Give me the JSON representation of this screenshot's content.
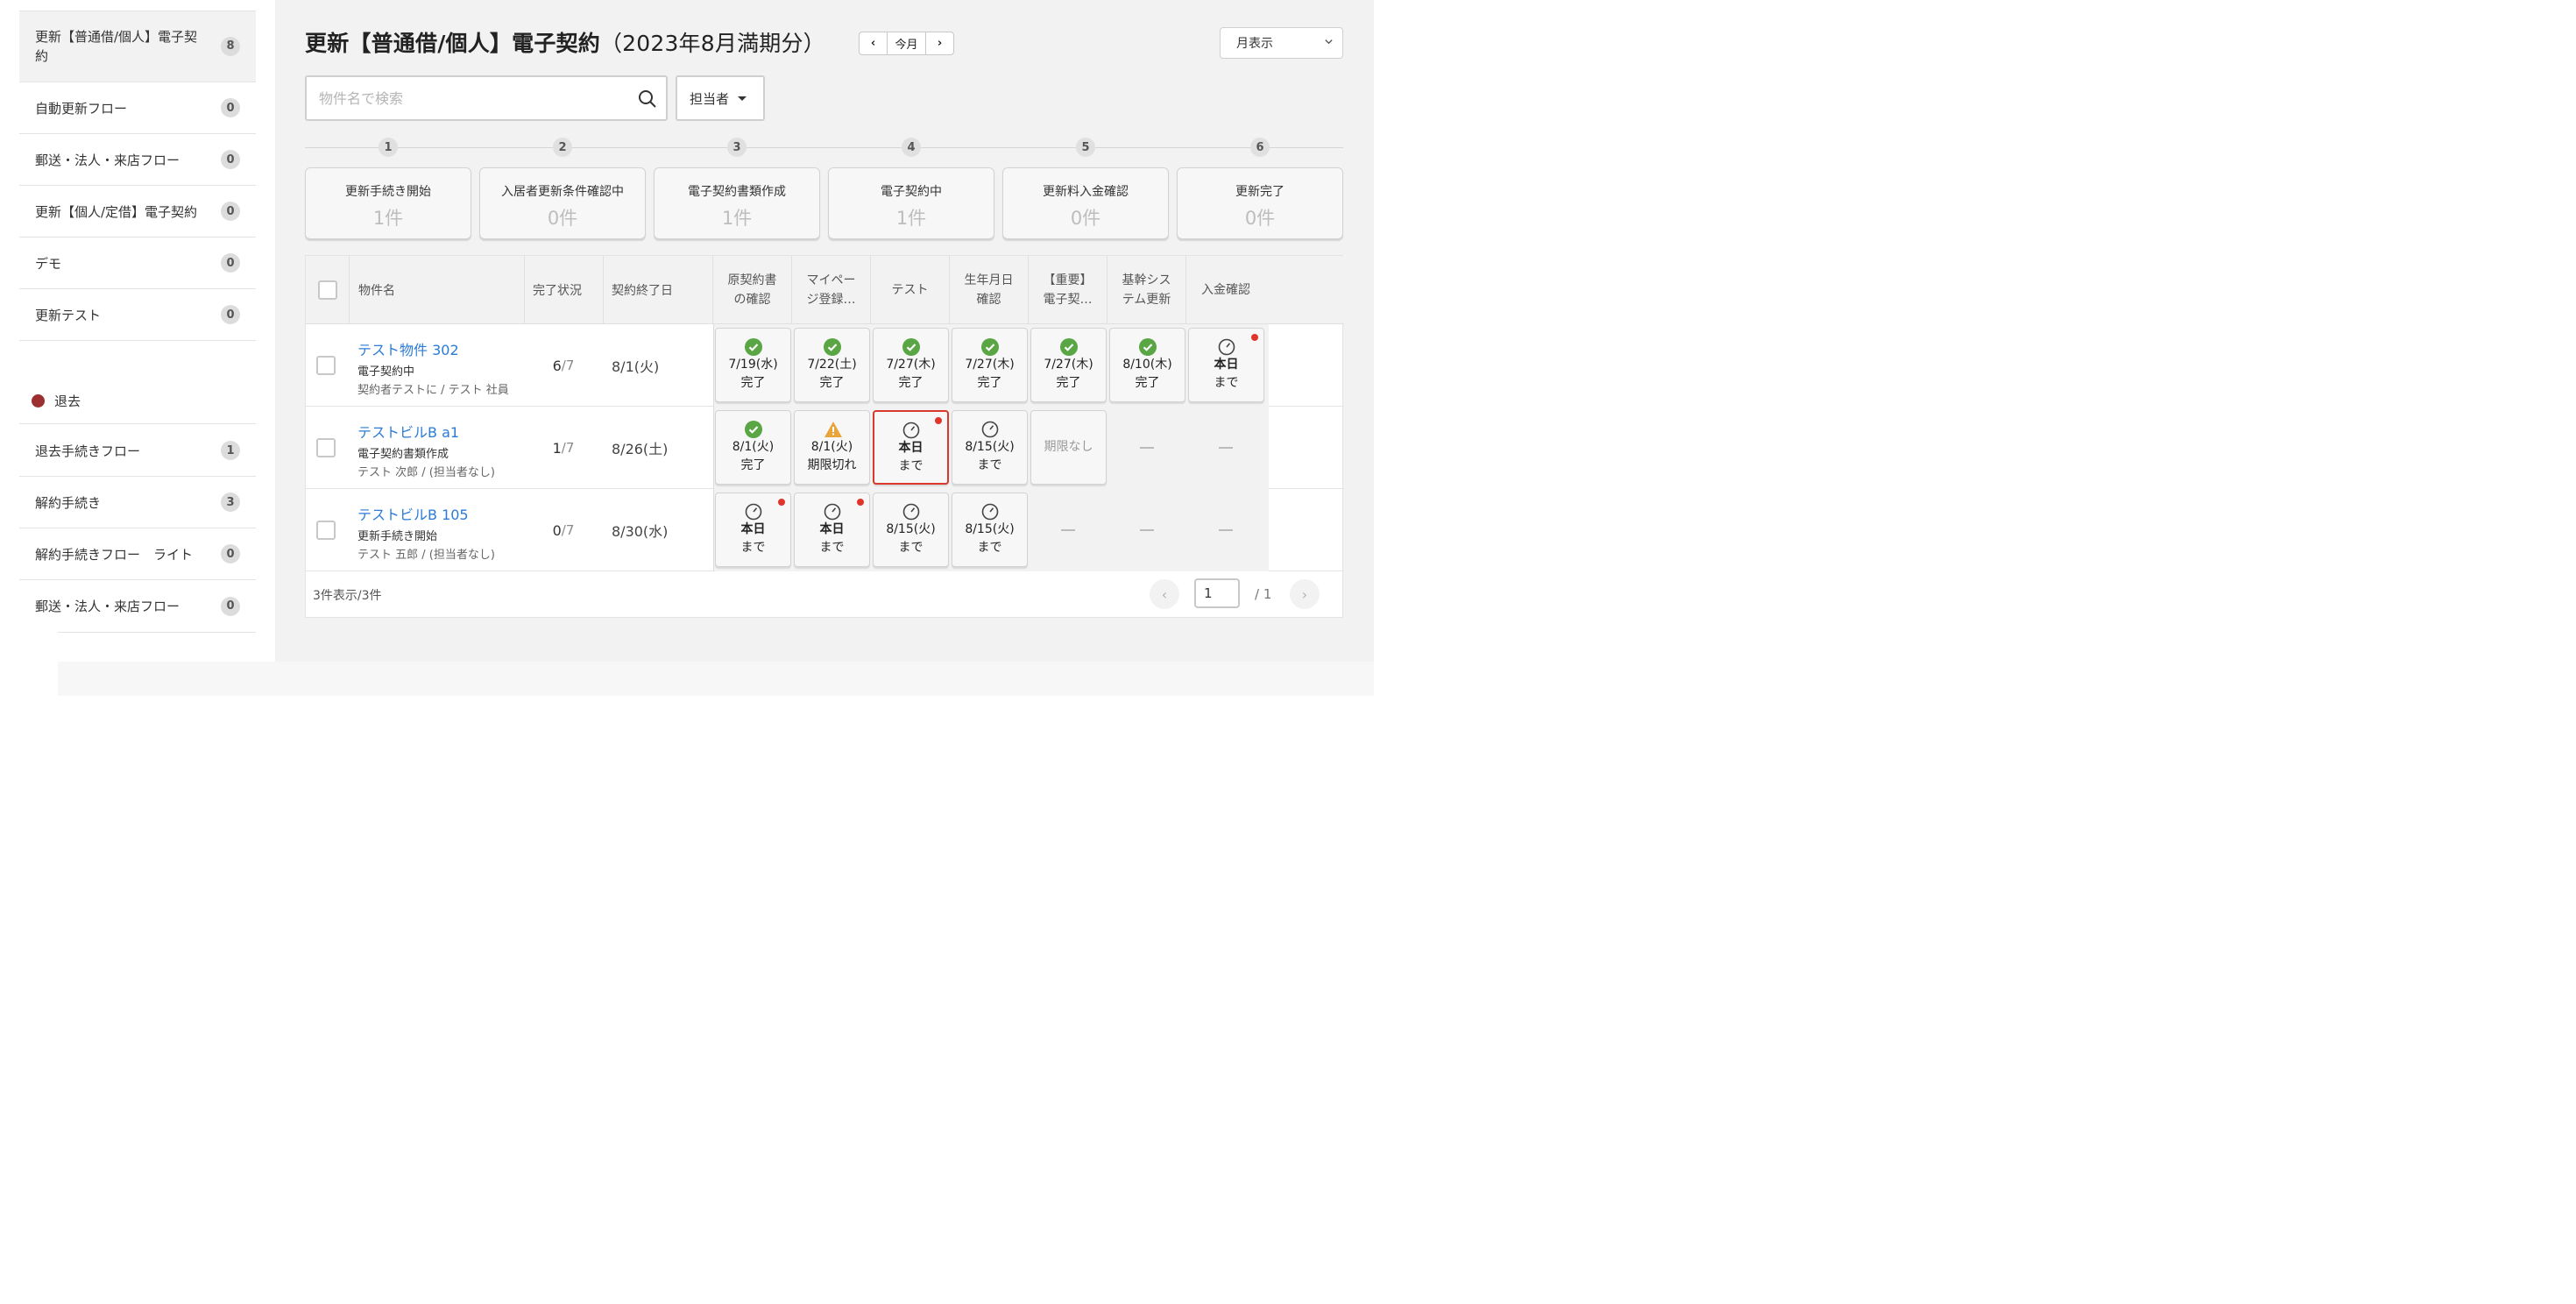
{
  "sidebar": {
    "items": [
      {
        "label": "更新【普通借/個人】電子契約",
        "count": "8"
      },
      {
        "label": "自動更新フロー",
        "count": "0"
      },
      {
        "label": "郵送・法人・来店フロー",
        "count": "0"
      },
      {
        "label": "更新【個人/定借】電子契約",
        "count": "0"
      },
      {
        "label": "デモ",
        "count": "0"
      },
      {
        "label": "更新テスト",
        "count": "0"
      }
    ],
    "section_label": "退去",
    "section_color": "#9c2f2f",
    "items2": [
      {
        "label": "退去手続きフロー",
        "count": "1"
      },
      {
        "label": "解約手続き",
        "count": "3"
      },
      {
        "label": "解約手続きフロー　ライト",
        "count": "0"
      },
      {
        "label": "郵送・法人・来店フロー",
        "count": "0"
      }
    ]
  },
  "header": {
    "title": "更新【普通借/個人】電子契約",
    "period": "（2023年8月満期分）",
    "prev": "‹",
    "today": "今月",
    "next": "›",
    "view_select": "月表示"
  },
  "search": {
    "placeholder": "物件名で検索",
    "value": ""
  },
  "assignee_label": "担当者",
  "steps": [
    {
      "num": "1",
      "label": "更新手続き開始",
      "count": "1件"
    },
    {
      "num": "2",
      "label": "入居者更新条件確認中",
      "count": "0件"
    },
    {
      "num": "3",
      "label": "電子契約書類作成",
      "count": "1件"
    },
    {
      "num": "4",
      "label": "電子契約中",
      "count": "1件"
    },
    {
      "num": "5",
      "label": "更新料入金確認",
      "count": "0件"
    },
    {
      "num": "6",
      "label": "更新完了",
      "count": "0件"
    }
  ],
  "table": {
    "headers": {
      "property": "物件名",
      "progress": "完了状況",
      "end_date": "契約終了日",
      "tasks": [
        "原契約書\nの確認",
        "マイペー\nジ登録…",
        "テスト",
        "生年月日\n確認",
        "【重要】\n電子契…",
        "基幹シス\nテム更新",
        "入金確認"
      ]
    },
    "rows": [
      {
        "name": "テスト物件 302",
        "status": "電子契約中",
        "person": "契約者テストに / テスト 社員",
        "done": "6",
        "total": "/7",
        "end_date": "8/1(火)",
        "tasks": [
          {
            "icon": "check-icon",
            "line1": "7/19(水)",
            "line2": "完了"
          },
          {
            "icon": "check-icon",
            "line1": "7/22(土)",
            "line2": "完了"
          },
          {
            "icon": "check-icon",
            "line1": "7/27(木)",
            "line2": "完了"
          },
          {
            "icon": "check-icon",
            "line1": "7/27(木)",
            "line2": "完了"
          },
          {
            "icon": "check-icon",
            "line1": "7/27(木)",
            "line2": "完了"
          },
          {
            "icon": "check-icon",
            "line1": "8/10(木)",
            "line2": "完了"
          },
          {
            "icon": "clock-icon",
            "line1": "本日",
            "line2": "まで"
          }
        ]
      },
      {
        "name": "テストビルB a1",
        "status": "電子契約書類作成",
        "person": "テスト 次郎 / (担当者なし)",
        "done": "1",
        "total": "/7",
        "end_date": "8/26(土)",
        "tasks": [
          {
            "icon": "check-icon",
            "line1": "8/1(火)",
            "line2": "完了"
          },
          {
            "icon": "warning-icon",
            "line1": "8/1(火)",
            "line2": "期限切れ"
          },
          {
            "icon": "clock-icon",
            "line1": "本日",
            "line2": "まで"
          },
          {
            "icon": "clock-icon",
            "line1": "8/15(火)",
            "line2": "まで"
          },
          {
            "line1": "期限なし"
          }
        ]
      },
      {
        "name": "テストビルB 105",
        "status": "更新手続き開始",
        "person": "テスト 五郎 / (担当者なし)",
        "done": "0",
        "total": "/7",
        "end_date": "8/30(水)",
        "tasks": [
          {
            "icon": "clock-icon",
            "line1": "本日",
            "line2": "まで"
          },
          {
            "icon": "clock-icon",
            "line1": "本日",
            "line2": "まで"
          },
          {
            "icon": "clock-icon",
            "line1": "8/15(火)",
            "line2": "まで"
          },
          {
            "icon": "clock-icon",
            "line1": "8/15(火)",
            "line2": "まで"
          }
        ]
      }
    ],
    "footer": "3件表示/3件"
  },
  "pagination": {
    "page": "1",
    "total": "/ 1",
    "prev": "‹",
    "next": "›"
  },
  "colors": {
    "link": "#2b7bd6",
    "check": "#5aa644",
    "warning": "#e9a53c",
    "alert_dot": "#e0352b",
    "highlight_border": "#d9382c"
  }
}
